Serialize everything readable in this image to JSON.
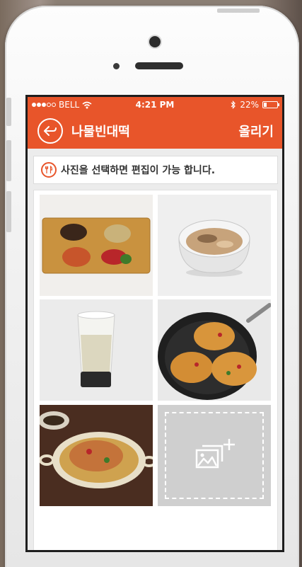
{
  "status_bar": {
    "carrier": "BELL",
    "time": "4:21 PM",
    "battery": "22%",
    "battery_level": 0.22
  },
  "nav_bar": {
    "title": "나물빈대떡",
    "action_label": "올리기",
    "back_icon": "back-arrow-icon"
  },
  "notice": {
    "text": "사진을 선택하면 편집이 가능 합니다.",
    "icon": "utensils-icon"
  },
  "photos": [
    {
      "subject": "ingredients-board"
    },
    {
      "subject": "glass-bowl-mix"
    },
    {
      "subject": "batter-glass"
    },
    {
      "subject": "frying-pan-pancakes"
    },
    {
      "subject": "plated-pancake"
    }
  ],
  "add_photo": {
    "icon": "add-photo-icon"
  },
  "colors": {
    "accent": "#e8552a",
    "background": "#ececec",
    "add_tile": "#cfcfcf"
  }
}
